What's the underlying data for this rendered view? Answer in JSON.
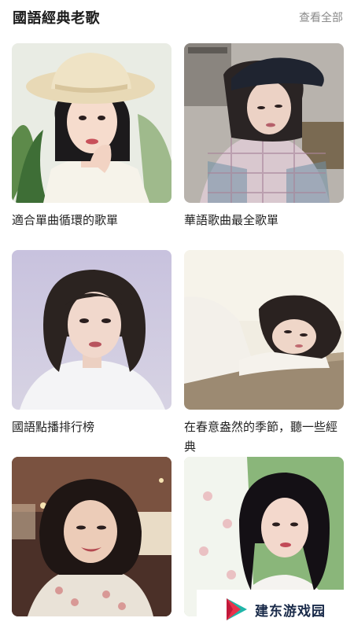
{
  "header": {
    "title": "國語經典老歌",
    "see_all": "查看全部"
  },
  "playlists": [
    {
      "title": "適合單曲循環的歌單"
    },
    {
      "title": "華語歌曲最全歌單"
    },
    {
      "title": "國語點播排行榜"
    },
    {
      "title": "在春意盎然的季節，聽一些經典"
    },
    {
      "title": ""
    },
    {
      "title": ""
    }
  ],
  "watermark": {
    "text": "建东游戏园"
  },
  "colors": {
    "accent_red": "#e8324a",
    "accent_teal": "#1fb5a8"
  }
}
